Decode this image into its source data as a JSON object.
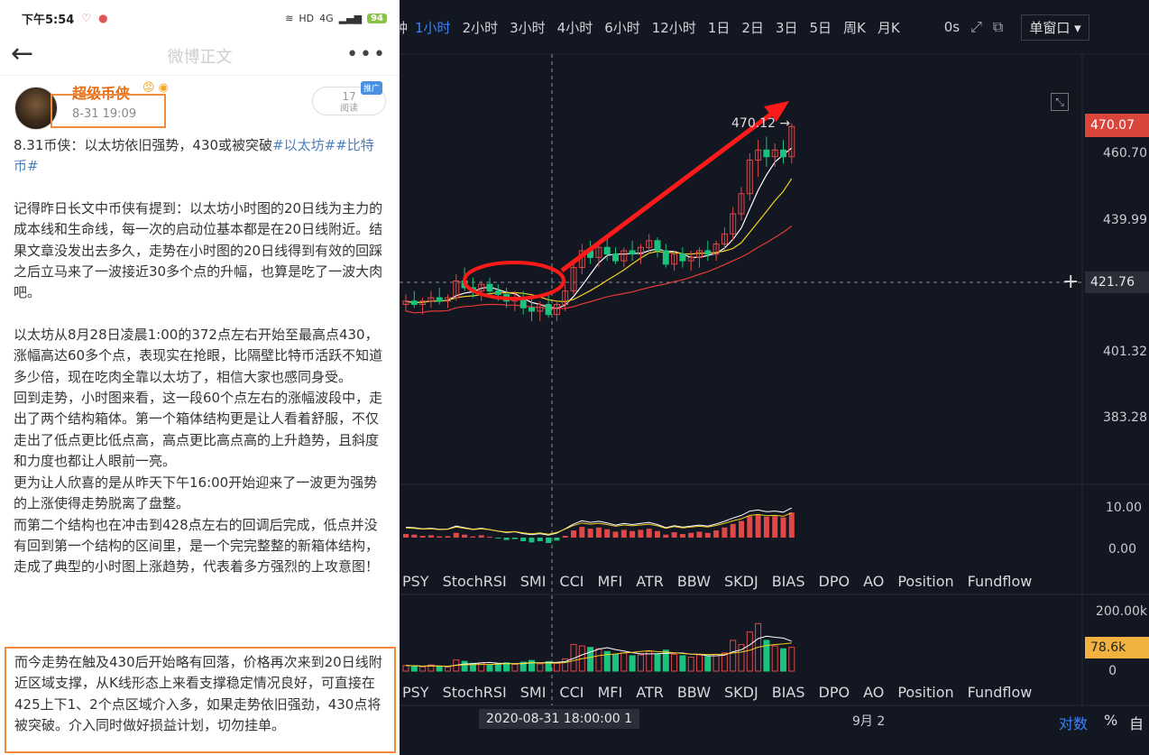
{
  "phone": {
    "status_bar": {
      "time": "下午5:54",
      "network_label": "HD",
      "signal_label": "4G",
      "battery": "94"
    },
    "nav": {
      "back_icon": "back-arrow-icon",
      "title": "微博正文",
      "more_icon": "more-dots-icon"
    },
    "author": {
      "name": "超级币侠",
      "post_date": "8-31 19:09",
      "read_count": "17",
      "read_label": "阅读",
      "promo_badge": "推广"
    },
    "post": {
      "headline_prefix": "8.31币侠：以太坊依旧强势，430或被突破",
      "hashtag_1": "#以太坊#",
      "hashtag_2": "#比特币#",
      "paragraphs": [
        "记得昨日长文中币侠有提到：以太坊小时图的20日线为主力的成本线和生命线，每一次的启动位基本都是在20日线附近。结果文章没发出去多久，走势在小时图的20日线得到有效的回踩之后立马来了一波接近30多个点的升幅，也算是吃了一波大肉吧。",
        "以太坊从8月28日凌晨1:00的372点左右开始至最高点430，涨幅高达60多个点，表现实在抢眼，比隔壁比特币活跃不知道多少倍，现在吃肉全靠以太坊了，相信大家也感同身受。",
        "回到走势，小时图来看，这一段60个点左右的涨幅波段中，走出了两个结构箱体。第一个箱体结构更是让人看着舒服，不仅走出了低点更比低点高，高点更比高点高的上升趋势，且斜度和力度也都让人眼前一亮。",
        "更为让人欣喜的是从昨天下午16:00开始迎来了一波更为强势的上涨使得走势脱离了盘整。",
        "而第二个结构也在冲击到428点左右的回调后完成，低点并没有回到第一个结构的区间里，是一个完完整整的新箱体结构，走成了典型的小时图上涨趋势，代表着多方强烈的上攻意图！"
      ],
      "highlight": "而今走势在触及430后开始略有回落，价格再次来到20日线附近区域支撑，从K线形态上来看支撑稳定情况良好，可直接在425上下1、2个点区域介入多，如果走势依旧强劲，430点将被突破。介入同时做好损益计划，切勿挂单。"
    }
  },
  "chart": {
    "toolbar": {
      "cut_tab": "钟",
      "timeframes": [
        "1小时",
        "2小时",
        "3小时",
        "4小时",
        "6小时",
        "12小时",
        "1日",
        "2日",
        "3日",
        "5日",
        "周K",
        "月K"
      ],
      "active_timeframe": "1小时",
      "interval_seconds": "0s",
      "window_mode": "单窗口"
    },
    "price_axis": [
      "460.70",
      "439.99",
      "401.32",
      "383.28"
    ],
    "current_price": "470.07",
    "cursor_price": "421.76",
    "peak_label": "470.12 →",
    "bias_axis": [
      "10.00",
      "0.00"
    ],
    "volume_axis": [
      "200.00k",
      "0"
    ],
    "volume_current": "78.6k",
    "indicator_tabs": [
      "PSY",
      "StochRSI",
      "SMI",
      "CCI",
      "MFI",
      "ATR",
      "BBW",
      "SKDJ",
      "BIAS",
      "DPO",
      "AO",
      "Position",
      "Fundflow"
    ],
    "time_axis": {
      "cursor_date": "2020-08-31 18:00:00",
      "cursor_tail": "1",
      "month_label": "9月 2",
      "log_label": "对数",
      "pct_label": "%",
      "auto_label": "自"
    },
    "colors": {
      "up": "#e04848",
      "down": "#19c37d",
      "ma_fast": "#ffffff",
      "ma_mid": "#f2d024",
      "ma_slow": "#e53935",
      "annotation": "#ff1a1a"
    },
    "candles": [
      {
        "o": 417,
        "h": 420,
        "l": 415,
        "c": 418
      },
      {
        "o": 418,
        "h": 421,
        "l": 416,
        "c": 417
      },
      {
        "o": 417,
        "h": 419,
        "l": 414,
        "c": 418
      },
      {
        "o": 418,
        "h": 421,
        "l": 416,
        "c": 419
      },
      {
        "o": 419,
        "h": 422,
        "l": 417,
        "c": 418
      },
      {
        "o": 418,
        "h": 420,
        "l": 416,
        "c": 419
      },
      {
        "o": 419,
        "h": 426,
        "l": 418,
        "c": 424
      },
      {
        "o": 424,
        "h": 428,
        "l": 421,
        "c": 422
      },
      {
        "o": 422,
        "h": 425,
        "l": 419,
        "c": 421
      },
      {
        "o": 421,
        "h": 424,
        "l": 418,
        "c": 423
      },
      {
        "o": 423,
        "h": 425,
        "l": 420,
        "c": 421
      },
      {
        "o": 421,
        "h": 423,
        "l": 418,
        "c": 420
      },
      {
        "o": 420,
        "h": 422,
        "l": 416,
        "c": 418
      },
      {
        "o": 418,
        "h": 421,
        "l": 415,
        "c": 419
      },
      {
        "o": 419,
        "h": 421,
        "l": 414,
        "c": 416
      },
      {
        "o": 416,
        "h": 419,
        "l": 412,
        "c": 415
      },
      {
        "o": 415,
        "h": 418,
        "l": 412,
        "c": 417
      },
      {
        "o": 417,
        "h": 420,
        "l": 413,
        "c": 414
      },
      {
        "o": 414,
        "h": 418,
        "l": 412,
        "c": 417
      },
      {
        "o": 417,
        "h": 423,
        "l": 415,
        "c": 421
      },
      {
        "o": 421,
        "h": 430,
        "l": 420,
        "c": 428
      },
      {
        "o": 428,
        "h": 435,
        "l": 426,
        "c": 433
      },
      {
        "o": 433,
        "h": 436,
        "l": 429,
        "c": 431
      },
      {
        "o": 431,
        "h": 435,
        "l": 428,
        "c": 434
      },
      {
        "o": 434,
        "h": 437,
        "l": 430,
        "c": 432
      },
      {
        "o": 432,
        "h": 434,
        "l": 429,
        "c": 430
      },
      {
        "o": 430,
        "h": 434,
        "l": 428,
        "c": 433
      },
      {
        "o": 433,
        "h": 436,
        "l": 430,
        "c": 432
      },
      {
        "o": 432,
        "h": 435,
        "l": 429,
        "c": 434
      },
      {
        "o": 434,
        "h": 438,
        "l": 432,
        "c": 436
      },
      {
        "o": 436,
        "h": 437,
        "l": 431,
        "c": 433
      },
      {
        "o": 433,
        "h": 435,
        "l": 428,
        "c": 429
      },
      {
        "o": 429,
        "h": 433,
        "l": 427,
        "c": 432
      },
      {
        "o": 432,
        "h": 434,
        "l": 428,
        "c": 430
      },
      {
        "o": 430,
        "h": 433,
        "l": 427,
        "c": 431
      },
      {
        "o": 431,
        "h": 434,
        "l": 428,
        "c": 433
      },
      {
        "o": 433,
        "h": 436,
        "l": 430,
        "c": 432
      },
      {
        "o": 432,
        "h": 436,
        "l": 430,
        "c": 435
      },
      {
        "o": 435,
        "h": 440,
        "l": 433,
        "c": 438
      },
      {
        "o": 438,
        "h": 446,
        "l": 436,
        "c": 444
      },
      {
        "o": 444,
        "h": 452,
        "l": 442,
        "c": 450
      },
      {
        "o": 450,
        "h": 462,
        "l": 448,
        "c": 460
      },
      {
        "o": 460,
        "h": 466,
        "l": 455,
        "c": 463
      },
      {
        "o": 463,
        "h": 467,
        "l": 458,
        "c": 461
      },
      {
        "o": 461,
        "h": 465,
        "l": 458,
        "c": 463
      },
      {
        "o": 463,
        "h": 466,
        "l": 459,
        "c": 461
      },
      {
        "o": 461,
        "h": 471,
        "l": 459,
        "c": 470
      }
    ],
    "bias_values": [
      1.2,
      1.0,
      0.6,
      0.8,
      0.4,
      0.5,
      1.6,
      1.0,
      0.4,
      0.8,
      0.3,
      -0.3,
      -0.8,
      -0.5,
      -1.2,
      -1.6,
      -1.2,
      -1.8,
      -1.0,
      0.6,
      2.4,
      3.6,
      3.0,
      3.4,
      2.8,
      2.0,
      2.6,
      2.2,
      2.6,
      3.0,
      2.2,
      1.0,
      1.8,
      1.2,
      1.6,
      2.0,
      1.6,
      2.4,
      3.4,
      4.6,
      5.6,
      7.2,
      7.6,
      7.0,
      7.2,
      6.8,
      8.4
    ],
    "volume_values": [
      20,
      18,
      15,
      22,
      16,
      14,
      40,
      35,
      28,
      30,
      22,
      26,
      30,
      24,
      32,
      38,
      26,
      34,
      28,
      44,
      95,
      90,
      85,
      80,
      70,
      60,
      65,
      55,
      58,
      70,
      62,
      75,
      60,
      55,
      50,
      58,
      52,
      60,
      65,
      110,
      95,
      140,
      170,
      110,
      90,
      80,
      85
    ]
  }
}
